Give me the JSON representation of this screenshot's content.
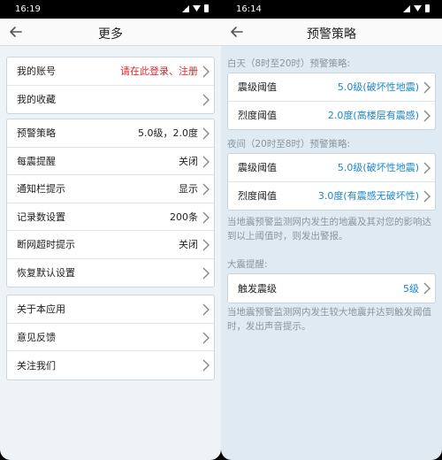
{
  "left": {
    "time": "16:19",
    "title": "更多",
    "groups": [
      [
        {
          "label": "我的账号",
          "value": "请在此登录、注册"
        },
        {
          "label": "我的收藏",
          "value": ""
        }
      ],
      [
        {
          "label": "预警策略",
          "value": "5.0级，2.0度"
        },
        {
          "label": "每震提醒",
          "value": "关闭"
        },
        {
          "label": "通知栏提示",
          "value": "显示"
        },
        {
          "label": "记录数设置",
          "value": "200条"
        },
        {
          "label": "断网超时提示",
          "value": "关闭"
        },
        {
          "label": "恢复默认设置",
          "value": ""
        }
      ],
      [
        {
          "label": "关于本应用",
          "value": ""
        },
        {
          "label": "意见反馈",
          "value": ""
        },
        {
          "label": "关注我们",
          "value": ""
        }
      ]
    ]
  },
  "right": {
    "time": "16:14",
    "title": "预警策略",
    "day_label": "白天（8时至20时）预警策略:",
    "day_rows": [
      {
        "label": "震级阈值",
        "value": "5.0级(破坏性地震)"
      },
      {
        "label": "烈度阈值",
        "value": "2.0度(高楼层有震感)"
      }
    ],
    "night_label": "夜间（20时至8时）预警策略:",
    "night_rows": [
      {
        "label": "震级阈值",
        "value": "5.0级(破坏性地震)"
      },
      {
        "label": "烈度阈值",
        "value": "3.0度(有震感无破坏性)"
      }
    ],
    "desc1": "当地震预警监测网内发生的地震及其对您的影响达到以上阈值时，则发出警报。",
    "quake_label": "大震提醒:",
    "quake_row": {
      "label": "触发震级",
      "value": "5级"
    },
    "desc2": "当地震预警监测网内发生较大地震并达到触发阈值时，发出声音提示。"
  },
  "colors": {
    "accent_red": "#e02424",
    "accent_blue": "#1c86c9",
    "muted_text": "#8a96a0"
  },
  "icons": {
    "back": "back-arrow-icon",
    "chevron": "chevron-right-icon",
    "signal": "signal-icon",
    "wifi": "wifi-icon",
    "battery": "battery-icon"
  }
}
